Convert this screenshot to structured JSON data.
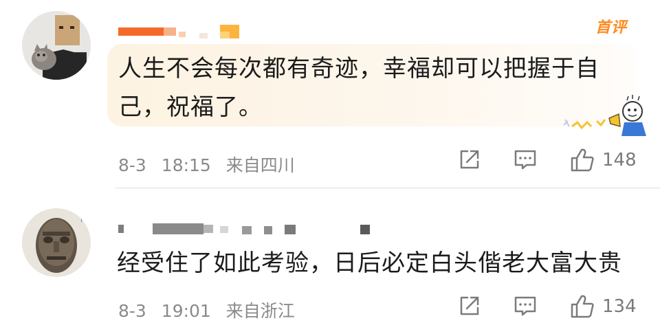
{
  "comments": [
    {
      "username": "",
      "badge": "首评",
      "text": "人生不会每次都有奇迹，幸福却可以把握于自己，祝福了。",
      "date": "8-3",
      "time": "18:15",
      "location": "来自四川",
      "likes": "148"
    },
    {
      "username": "",
      "text": "经受住了如此考验，日后必定白头偕老大富大贵",
      "date": "8-3",
      "time": "19:01",
      "location": "来自浙江",
      "likes": "134"
    }
  ],
  "colors": {
    "badge": "#ff8a1f",
    "bubble": "#fdf3e2",
    "meta": "#8a8a8a"
  },
  "icons": [
    "share-icon",
    "comment-icon",
    "like-icon"
  ]
}
